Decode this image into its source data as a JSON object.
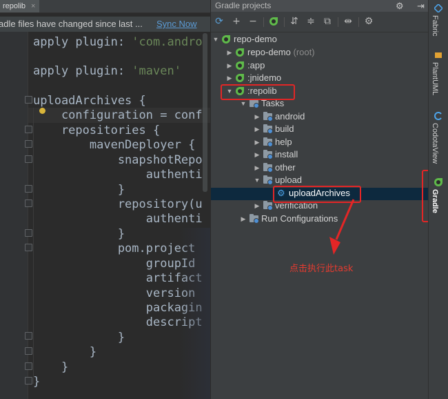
{
  "editor": {
    "tab_label": "repolib",
    "tab_close": "×",
    "notification": "adle files have changed since last ...",
    "sync_link": "Sync Now",
    "lines": [
      {
        "parts": [
          [
            "plain",
            "apply plugin: "
          ],
          [
            "str",
            "'com.andro"
          ]
        ]
      },
      {
        "parts": [
          [
            "plain",
            "apply plugin: "
          ],
          [
            "str",
            "'maven'"
          ]
        ]
      },
      {
        "parts": [
          [
            "plain",
            "uploadArchives {"
          ]
        ]
      },
      {
        "parts": [
          [
            "plain",
            "    configuration = conf"
          ]
        ]
      },
      {
        "parts": [
          [
            "plain",
            "    repositories {"
          ]
        ]
      },
      {
        "parts": [
          [
            "plain",
            "        mavenDeployer {"
          ]
        ]
      },
      {
        "parts": [
          [
            "plain",
            "            snapshotRepo"
          ]
        ]
      },
      {
        "parts": [
          [
            "plain",
            "                authenti"
          ]
        ]
      },
      {
        "parts": [
          [
            "plain",
            "            }"
          ]
        ]
      },
      {
        "parts": [
          [
            "plain",
            "            repository(u"
          ]
        ]
      },
      {
        "parts": [
          [
            "plain",
            "                authenti"
          ]
        ]
      },
      {
        "parts": [
          [
            "plain",
            "            }"
          ]
        ]
      },
      {
        "parts": [
          [
            "plain",
            "            pom.project"
          ]
        ]
      },
      {
        "parts": [
          [
            "plain",
            "                groupId"
          ]
        ]
      },
      {
        "parts": [
          [
            "plain",
            "                artifact"
          ]
        ]
      },
      {
        "parts": [
          [
            "plain",
            "                version"
          ]
        ]
      },
      {
        "parts": [
          [
            "plain",
            "                packagin"
          ]
        ]
      },
      {
        "parts": [
          [
            "plain",
            "                descript"
          ]
        ]
      },
      {
        "parts": [
          [
            "plain",
            "            }"
          ]
        ]
      },
      {
        "parts": [
          [
            "plain",
            "        }"
          ]
        ]
      },
      {
        "parts": [
          [
            "plain",
            "    }"
          ]
        ]
      },
      {
        "parts": [
          [
            "plain",
            "}"
          ]
        ]
      }
    ]
  },
  "gradle_panel": {
    "title": "Gradle projects",
    "settings_glyph": "⚙",
    "hide_glyph": "⇥",
    "toolbar_icons": [
      "refresh-icon",
      "add-icon",
      "remove-icon",
      "execute-gradle-task-icon",
      "expand-all-icon",
      "collapse-all-icon",
      "link-icon",
      "toggle-offline-icon",
      "settings-icon"
    ],
    "tree": [
      {
        "label": "repo-demo",
        "suffix": "",
        "icon": "gradle",
        "expanded": true
      },
      {
        "label": "repo-demo",
        "suffix": " (root)",
        "icon": "gradle",
        "expanded": false
      },
      {
        "label": ":app",
        "suffix": "",
        "icon": "gradle",
        "expanded": false
      },
      {
        "label": ":jnidemo",
        "suffix": "",
        "icon": "gradle",
        "expanded": false
      },
      {
        "label": ":repolib",
        "suffix": "",
        "icon": "gradle",
        "expanded": true
      },
      {
        "label": "Tasks",
        "suffix": "",
        "icon": "folder",
        "expanded": true
      },
      {
        "label": "android",
        "suffix": "",
        "icon": "folder",
        "expanded": false
      },
      {
        "label": "build",
        "suffix": "",
        "icon": "folder",
        "expanded": false
      },
      {
        "label": "help",
        "suffix": "",
        "icon": "folder",
        "expanded": false
      },
      {
        "label": "install",
        "suffix": "",
        "icon": "folder",
        "expanded": false
      },
      {
        "label": "other",
        "suffix": "",
        "icon": "folder",
        "expanded": false
      },
      {
        "label": "upload",
        "suffix": "",
        "icon": "folder",
        "expanded": true
      },
      {
        "label": "uploadArchives",
        "suffix": "",
        "icon": "gear",
        "selected": true
      },
      {
        "label": "verification",
        "suffix": "",
        "icon": "folder",
        "expanded": false
      },
      {
        "label": "Run Configurations",
        "suffix": "",
        "icon": "folder",
        "expanded": false
      }
    ]
  },
  "annotation": {
    "note": "点击执行此task",
    "color": "#e32626"
  },
  "right_strip": {
    "tabs": [
      "Fabric",
      "PlantUML",
      "CodotaView",
      "Gradle"
    ]
  },
  "colors": {
    "keyword": "#cc7832",
    "string": "#6a8759",
    "text": "#a9b7c6",
    "link": "#5b9bd5",
    "gradle_green": "#5fba4a"
  }
}
